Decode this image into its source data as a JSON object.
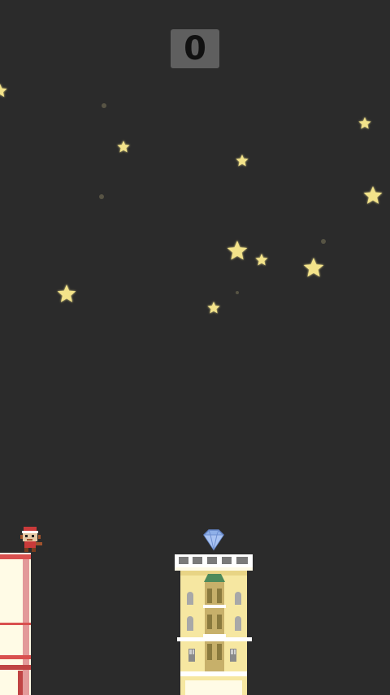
{
  "hud": {
    "score": "0"
  },
  "player": {
    "sprite": "monkey-character-icon"
  },
  "pickup": {
    "sprite": "diamond-gem-icon",
    "color": "#8fb0e8"
  },
  "scene": {
    "background": "#2b2b2b",
    "star_color": "#f3e38a",
    "building_left_color": "#d9504f",
    "building_right_color": "#f6e7a1",
    "building_right_door_color": "#4d8a5b"
  }
}
